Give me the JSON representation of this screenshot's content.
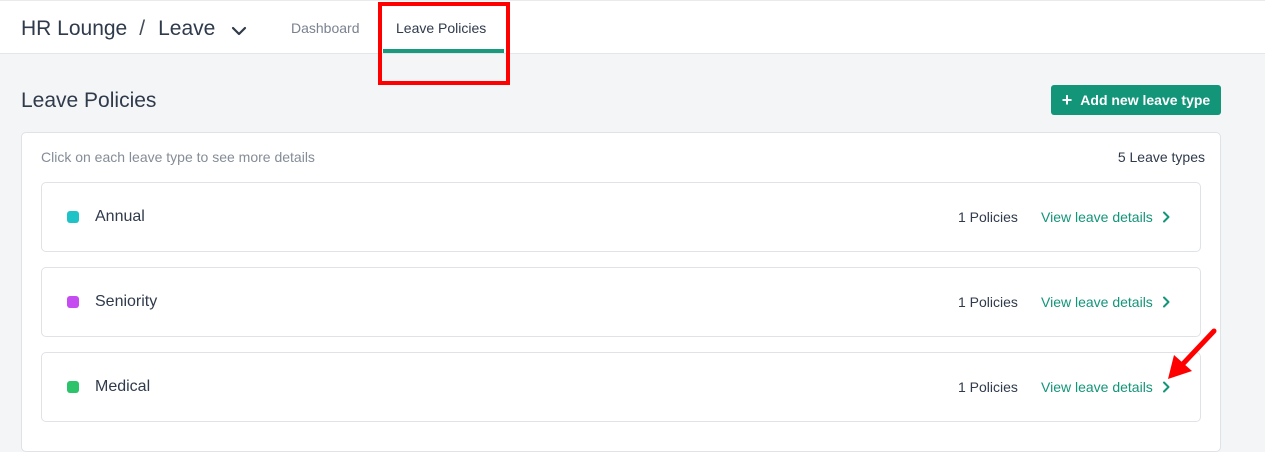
{
  "header": {
    "brand": "HR Lounge",
    "separator": "/",
    "module": "Leave",
    "tabs": [
      {
        "label": "Dashboard",
        "active": false
      },
      {
        "label": "Leave Policies",
        "active": true
      }
    ]
  },
  "page": {
    "title": "Leave Policies",
    "add_button_label": "Add new leave type"
  },
  "panel": {
    "hint": "Click on each leave type to see more details",
    "count_label": "5 Leave types",
    "leave_types": [
      {
        "name": "Annual",
        "color": "#1ec3c8",
        "policies": "1 Policies",
        "link": "View leave details"
      },
      {
        "name": "Seniority",
        "color": "#c44cf0",
        "policies": "1 Policies",
        "link": "View leave details"
      },
      {
        "name": "Medical",
        "color": "#2cc36b",
        "policies": "1 Policies",
        "link": "View leave details"
      }
    ]
  },
  "colors": {
    "accent": "#13957a",
    "annotation": "#ff0000"
  }
}
